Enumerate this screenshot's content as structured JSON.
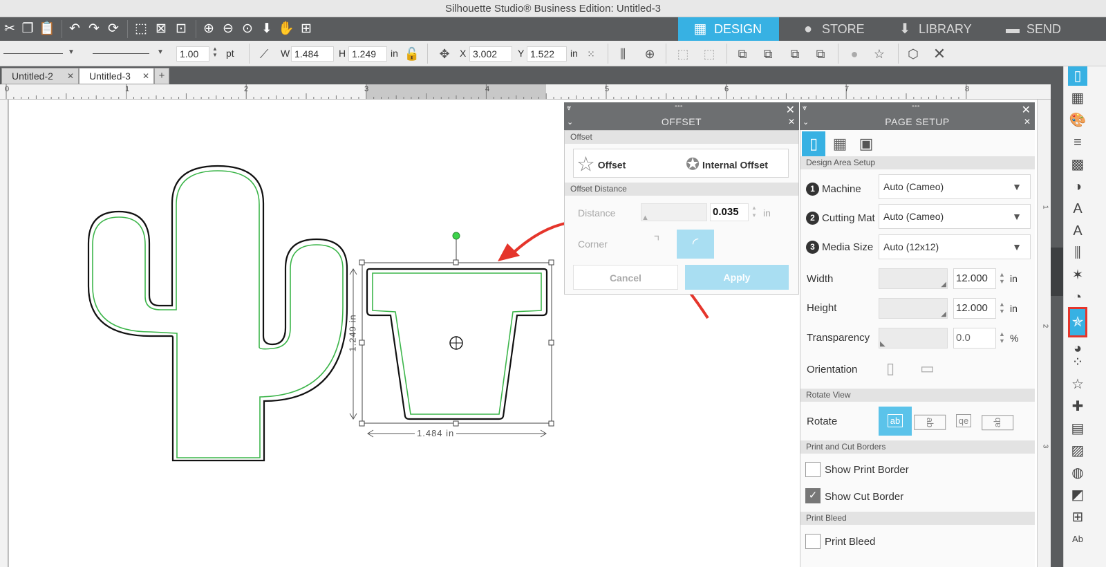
{
  "window": {
    "title": "Silhouette Studio® Business Edition: Untitled-3"
  },
  "nav_tabs": [
    {
      "label": "DESIGN",
      "icon": "grid-icon",
      "active": true
    },
    {
      "label": "STORE",
      "icon": "store-s-icon",
      "active": false
    },
    {
      "label": "LIBRARY",
      "icon": "library-download-icon",
      "active": false
    },
    {
      "label": "SEND",
      "icon": "send-machine-icon",
      "active": false
    }
  ],
  "properties": {
    "line_width": "1.00",
    "line_unit": "pt",
    "w_label": "W",
    "w_value": "1.484",
    "h_label": "H",
    "h_value": "1.249",
    "size_unit": "in",
    "x_label": "X",
    "x_value": "3.002",
    "y_label": "Y",
    "y_value": "1.522",
    "pos_unit": "in"
  },
  "doc_tabs": [
    {
      "label": "Untitled-2",
      "active": false
    },
    {
      "label": "Untitled-3",
      "active": true
    }
  ],
  "ruler": {
    "ticks": [
      "0",
      "1",
      "2",
      "3",
      "4",
      "5",
      "6",
      "7",
      "8"
    ]
  },
  "selection": {
    "width_label": "1.484 in",
    "height_label": "1.249 in"
  },
  "offset_panel": {
    "title": "OFFSET",
    "section_offset": "Offset",
    "option_offset": "Offset",
    "option_internal": "Internal Offset",
    "section_distance": "Offset Distance",
    "distance_label": "Distance",
    "distance_value": "0.035",
    "distance_unit": "in",
    "corner_label": "Corner",
    "cancel_label": "Cancel",
    "apply_label": "Apply"
  },
  "page_setup": {
    "title": "PAGE SETUP",
    "section_design_area": "Design Area Setup",
    "machine_num": "1",
    "machine_label": "Machine",
    "machine_value": "Auto (Cameo)",
    "mat_num": "2",
    "mat_label": "Cutting Mat",
    "mat_value": "Auto (Cameo)",
    "media_num": "3",
    "media_label": "Media Size",
    "media_value": "Auto (12x12)",
    "width_label": "Width",
    "width_value": "12.000",
    "width_unit": "in",
    "height_label": "Height",
    "height_value": "12.000",
    "height_unit": "in",
    "transparency_label": "Transparency",
    "transparency_value": "0.0",
    "transparency_unit": "%",
    "orientation_label": "Orientation",
    "section_rotate": "Rotate View",
    "rotate_label": "Rotate",
    "rotate_options": [
      "ab",
      "ab",
      "qe",
      "ab"
    ],
    "section_borders": "Print and Cut Borders",
    "show_print_border": "Show Print Border",
    "show_cut_border": "Show Cut Border",
    "section_bleed": "Print Bleed",
    "print_bleed": "Print Bleed"
  },
  "colors": {
    "accent": "#37b1e3",
    "toolbar": "#5a5c5e",
    "cut_line_green": "#3cb54a",
    "arrow_red": "#e5352b"
  }
}
